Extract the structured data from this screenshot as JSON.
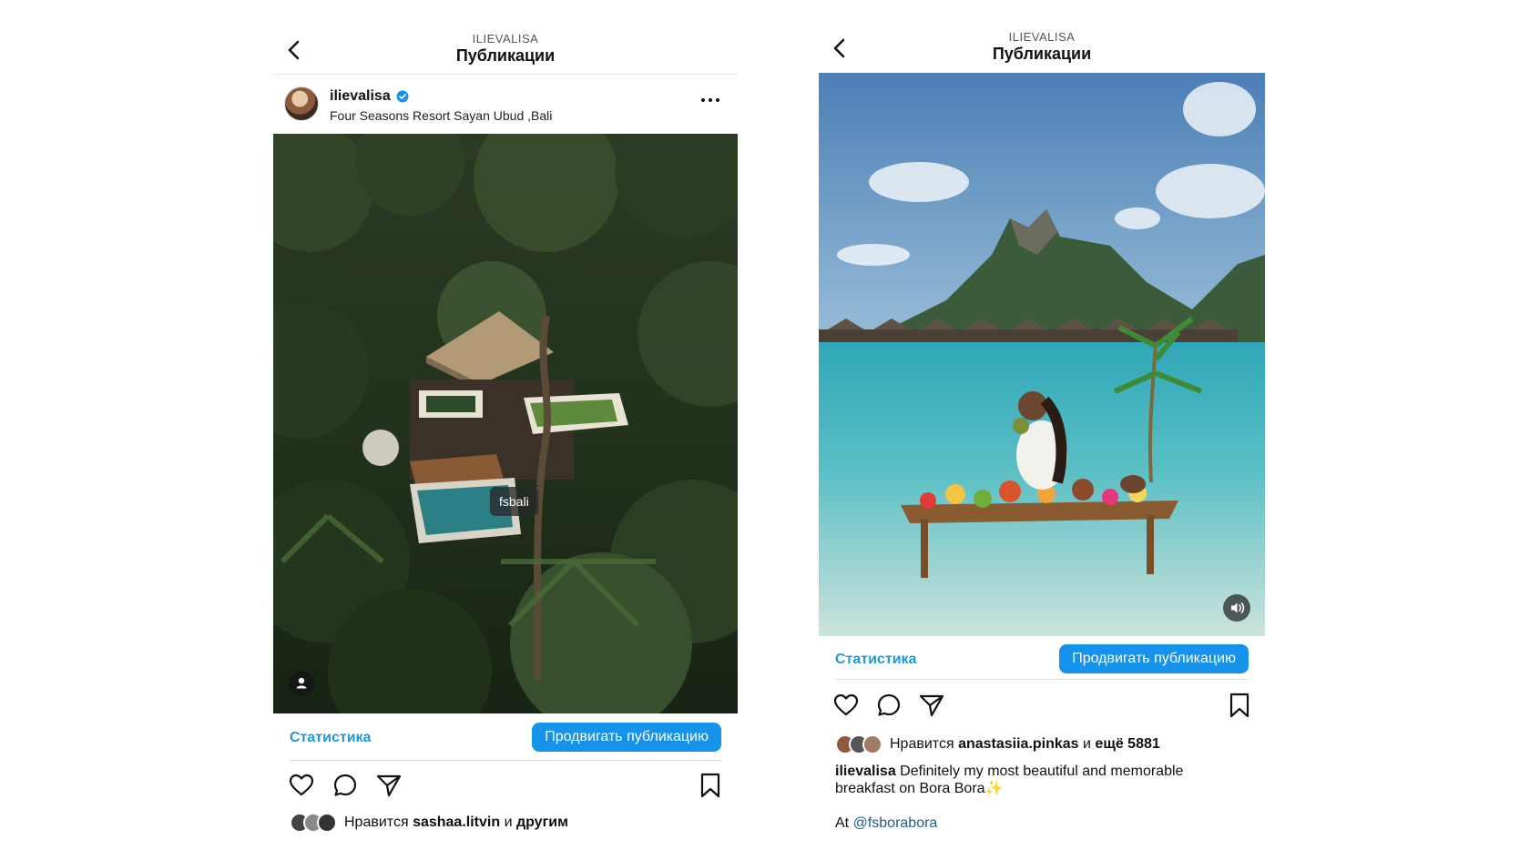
{
  "left": {
    "header": {
      "kicker": "ILIEVALISA",
      "title": "Публикации"
    },
    "post": {
      "username": "ilievalisa",
      "location": "Four Seasons Resort Sayan Ubud ,Bali",
      "tag": "fsbali"
    },
    "actions": {
      "stats_label": "Статистика",
      "promote_label": "Продвигать публикацию"
    },
    "likes": {
      "prefix": "Нравится",
      "user": "sashaa.litvin",
      "conj": "и",
      "rest": "другим"
    }
  },
  "right": {
    "header": {
      "kicker": "ILIEVALISA",
      "title": "Публикации"
    },
    "actions": {
      "stats_label": "Статистика",
      "promote_label": "Продвигать публикацию"
    },
    "likes": {
      "prefix": "Нравится",
      "user": "anastasiia.pinkas",
      "conj": "и",
      "rest": "ещё 5881"
    },
    "caption": {
      "username": "ilievalisa",
      "text": "Definitely my most beautiful and memorable breakfast on Bora Bora",
      "sparkle": "✨"
    },
    "at_line": {
      "prefix": "At",
      "mention": "@fsborabora"
    }
  },
  "colors": {
    "accent": "#1592ea",
    "link": "#2197d8",
    "mention": "#1f5b8f"
  },
  "icons": [
    "back-icon",
    "verified-icon",
    "more-icon",
    "heart-icon",
    "comment-icon",
    "share-icon",
    "bookmark-icon",
    "sound-icon",
    "person-tag-icon"
  ]
}
